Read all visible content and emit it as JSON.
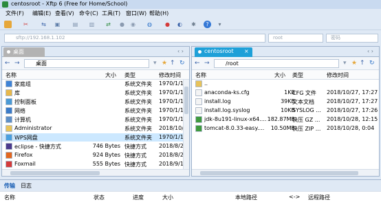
{
  "window": {
    "title": "centosroot  - Xftp 6 (Free for Home/School)"
  },
  "menu": [
    "文件(F)",
    "编辑(E)",
    "查看(V)",
    "命令(C)",
    "工具(T)",
    "窗口(W)",
    "帮助(H)"
  ],
  "addressbar": {
    "host_placeholder": "sftp://192.168.1.102",
    "user_placeholder": "root",
    "password_placeholder": "密码"
  },
  "left_pane": {
    "tab_label": "桌面",
    "path": "桌面",
    "columns": [
      "名称",
      "大小",
      "类型",
      "修改时间"
    ],
    "rows": [
      {
        "name": "家庭组",
        "size": "",
        "type": "系统文件夹",
        "modified": "1970/1/1",
        "icon": "homegroup-icon",
        "color": "#3f83d6"
      },
      {
        "name": "库",
        "size": "",
        "type": "系统文件夹",
        "modified": "1970/1/1",
        "icon": "library-icon",
        "color": "#e8b84a"
      },
      {
        "name": "控制面板",
        "size": "",
        "type": "系统文件夹",
        "modified": "1970/1/1",
        "icon": "control-panel-icon",
        "color": "#4a9ad6"
      },
      {
        "name": "网络",
        "size": "",
        "type": "系统文件夹",
        "modified": "1970/1/1",
        "icon": "network-icon",
        "color": "#3b7bc9"
      },
      {
        "name": "计算机",
        "size": "",
        "type": "系统文件夹",
        "modified": "1970/1/1",
        "icon": "computer-icon",
        "color": "#5e8fc7"
      },
      {
        "name": "Administrator",
        "size": "",
        "type": "系统文件夹",
        "modified": "2018/10/",
        "icon": "user-folder-icon",
        "color": "#e8c35a"
      },
      {
        "name": "WPS网盘",
        "size": "",
        "type": "系统文件夹",
        "modified": "1970/1/1",
        "icon": "cloud-icon",
        "color": "#4aa0e0",
        "selected": true
      },
      {
        "name": "eclipse - 快捷方式",
        "size": "746 Bytes",
        "type": "快捷方式",
        "modified": "2018/8/2",
        "icon": "eclipse-icon",
        "color": "#4b3a8c"
      },
      {
        "name": "Firefox",
        "size": "924 Bytes",
        "type": "快捷方式",
        "modified": "2018/8/2",
        "icon": "firefox-icon",
        "color": "#e2661f"
      },
      {
        "name": "Foxmail",
        "size": "555 Bytes",
        "type": "快捷方式",
        "modified": "2018/9/1",
        "icon": "foxmail-icon",
        "color": "#d43b3b"
      }
    ]
  },
  "right_pane": {
    "tab_label": "centosroot",
    "path": "/root",
    "columns": [
      "名称",
      "大小",
      "类型",
      "修改时间"
    ],
    "rows": [
      {
        "name": "..",
        "size": "",
        "type": "",
        "modified": "",
        "icon": "parent-folder-icon",
        "color": "#e8c35a"
      },
      {
        "name": "anaconda-ks.cfg",
        "size": "1KB",
        "type": "CFG 文件",
        "modified": "2018/10/27, 17:27",
        "icon": "file-icon",
        "color": "#f4f4f4"
      },
      {
        "name": "install.log",
        "size": "39KB",
        "type": "文本文档",
        "modified": "2018/10/27, 17:27",
        "icon": "text-file-icon",
        "color": "#f4f4f4"
      },
      {
        "name": "install.log.syslog",
        "size": "10KB",
        "type": "SYSLOG ...",
        "modified": "2018/10/27, 17:26",
        "icon": "file-icon",
        "color": "#f4f4f4"
      },
      {
        "name": "jdk-8u191-linux-x64....",
        "size": "182.87MB",
        "type": "快压 GZ ...",
        "modified": "2018/10/28, 12:15",
        "icon": "archive-icon",
        "color": "#3f9a3f"
      },
      {
        "name": "tomcat-8.0.33-easy....",
        "size": "10.50MB",
        "type": "快压 ZIP ...",
        "modified": "2018/10/28, 0:04",
        "icon": "archive-icon",
        "color": "#3f9a3f"
      }
    ]
  },
  "bottom": {
    "tabs": [
      "传输",
      "日志"
    ],
    "columns": [
      "名称",
      "状态",
      "进度",
      "大小",
      "本地路径",
      "<->",
      "远程路径"
    ]
  }
}
